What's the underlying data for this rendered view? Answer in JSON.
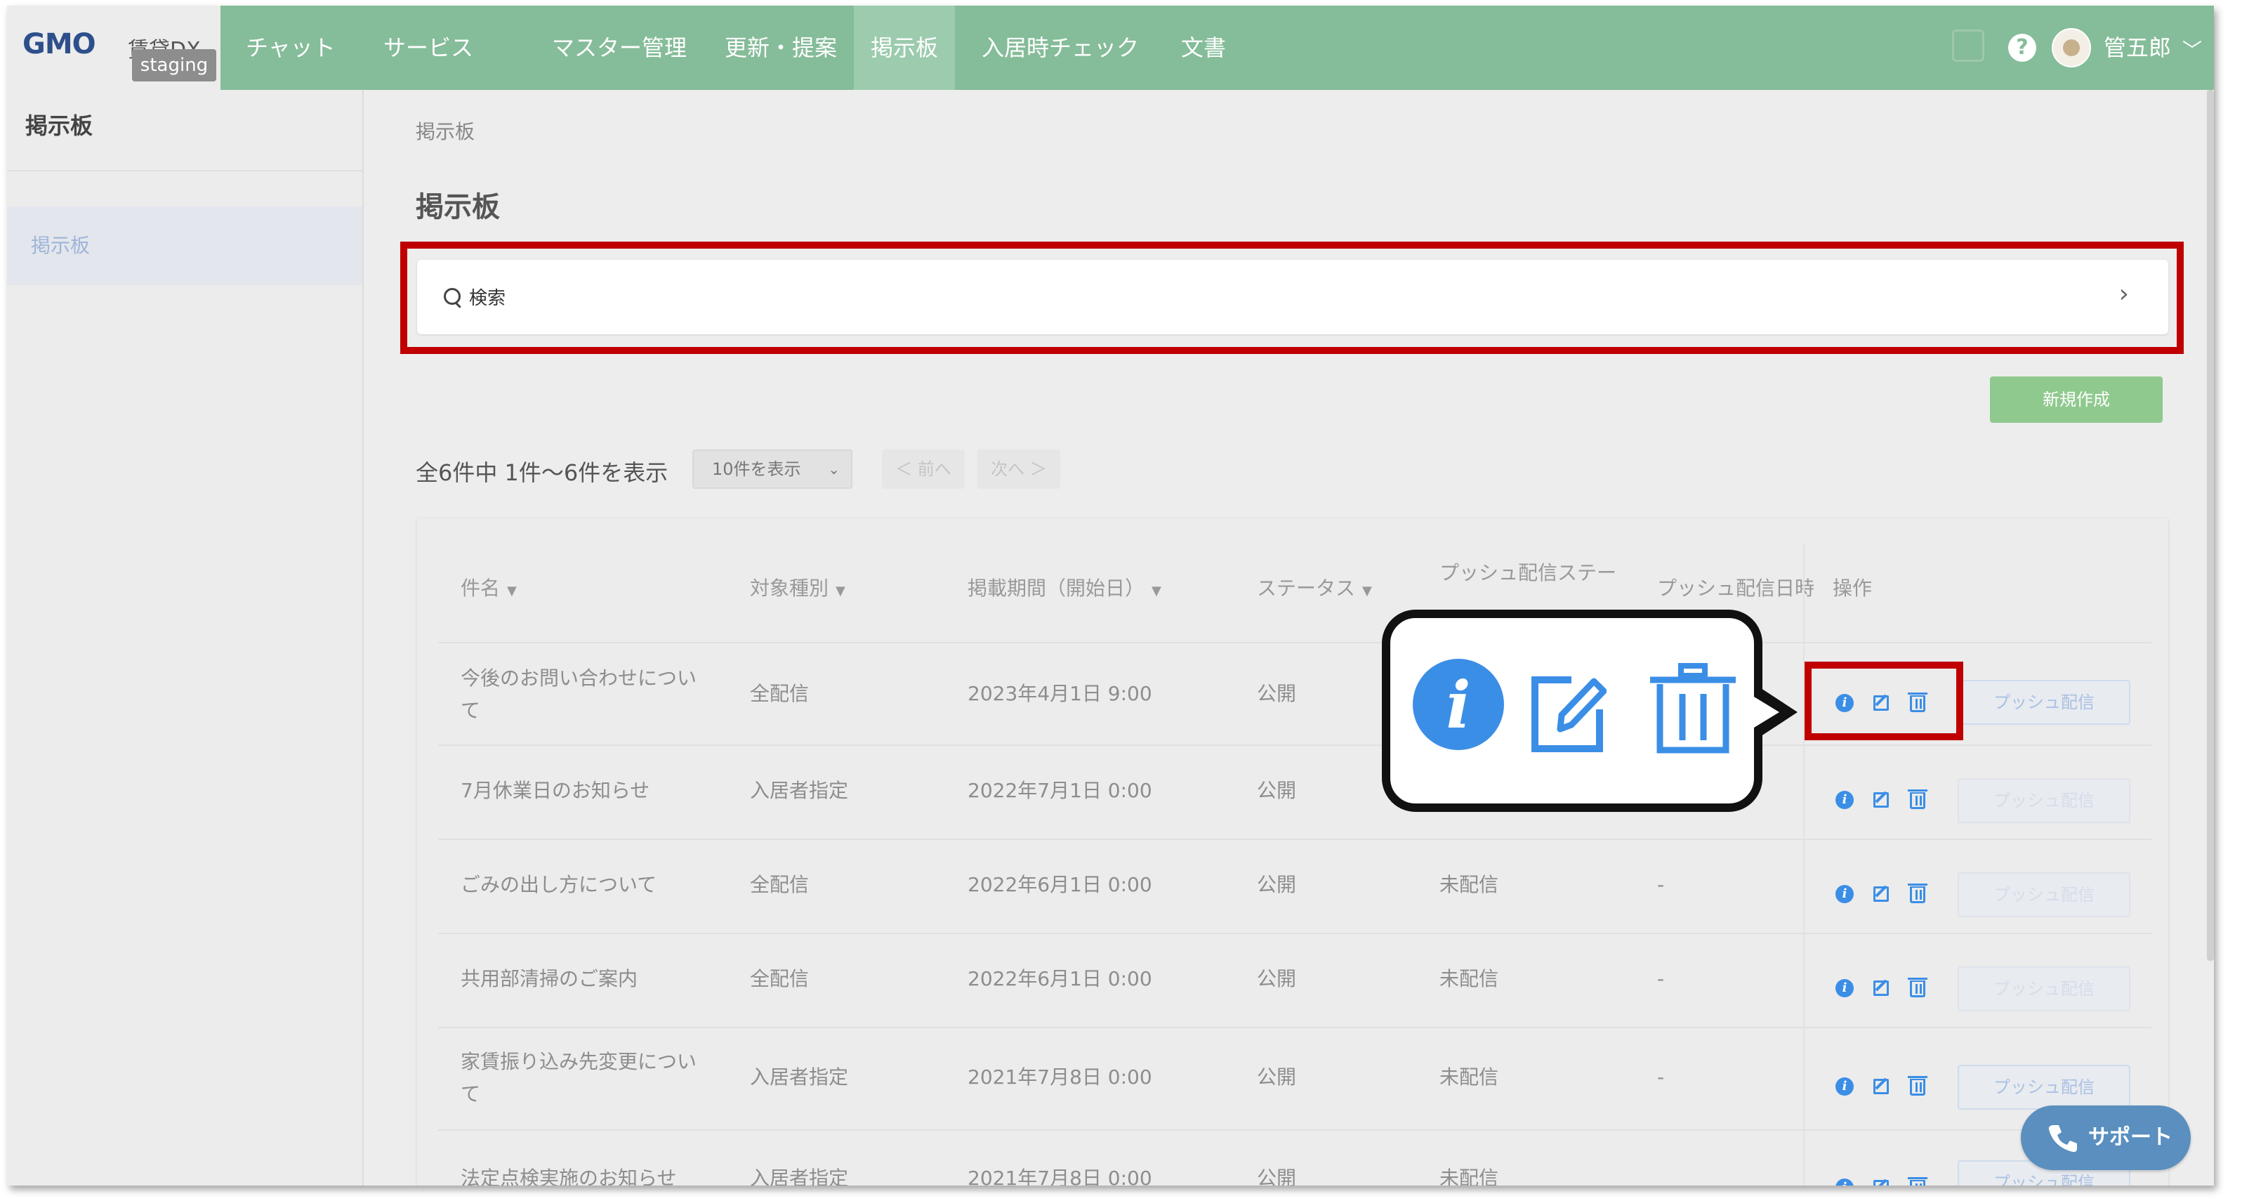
{
  "header": {
    "logo": "GMO",
    "logo_sub": "賃貸DX",
    "env_badge": "staging",
    "nav": [
      {
        "label": "チャット"
      },
      {
        "label": "サービス"
      },
      {
        "label": "マスター管理"
      },
      {
        "label": "更新・提案"
      },
      {
        "label": "掲示板",
        "active": true
      },
      {
        "label": "入居時チェック"
      },
      {
        "label": "文書"
      }
    ],
    "help": "?",
    "user_name": "管五郎",
    "user_menu_chevron": "﹀"
  },
  "sidebar": {
    "title": "掲示板",
    "items": [
      {
        "label": "掲示板",
        "active": true
      }
    ]
  },
  "main": {
    "breadcrumb": "掲示板",
    "page_title": "掲示板",
    "search": {
      "label": "検索",
      "chevron": "›"
    },
    "new_button": "新規作成",
    "count_text": "全6件中 1件〜6件を表示",
    "per_page": {
      "selected": "10件を表示",
      "caret": "⌄"
    },
    "prev_button": "＜ 前へ",
    "next_button": "次へ ＞",
    "columns": [
      "件名",
      "対象種別",
      "掲載期間（開始日）",
      "ステータス",
      "プッシュ配信ステー",
      "プッシュ配信日時",
      "操作"
    ],
    "sort_indicator": "▼",
    "rows": [
      {
        "title_l1": "今後のお問い合わせについ",
        "title_l2": "て",
        "target": "全配信",
        "start": "2023年4月1日 9:00",
        "status": "公開",
        "push_status": "",
        "push_date": "",
        "push_enabled": true
      },
      {
        "title_l1": "7月休業日のお知らせ",
        "title_l2": "",
        "target": "入居者指定",
        "start": "2022年7月1日 0:00",
        "status": "公開",
        "push_status": "",
        "push_date": "",
        "push_enabled": false
      },
      {
        "title_l1": "ごみの出し方について",
        "title_l2": "",
        "target": "全配信",
        "start": "2022年6月1日 0:00",
        "status": "公開",
        "push_status": "未配信",
        "push_date": "-",
        "push_enabled": false
      },
      {
        "title_l1": "共用部清掃のご案内",
        "title_l2": "",
        "target": "全配信",
        "start": "2022年6月1日 0:00",
        "status": "公開",
        "push_status": "未配信",
        "push_date": "-",
        "push_enabled": false
      },
      {
        "title_l1": "家賃振り込み先変更につい",
        "title_l2": "て",
        "target": "入居者指定",
        "start": "2021年7月8日 0:00",
        "status": "公開",
        "push_status": "未配信",
        "push_date": "-",
        "push_enabled": true
      },
      {
        "title_l1": "法定点検実施のお知らせ",
        "title_l2": "",
        "target": "入居者指定",
        "start": "2021年7月8日 0:00",
        "status": "公開",
        "push_status": "未配信",
        "push_date": "",
        "push_enabled": true
      }
    ],
    "push_button": "プッシュ配信",
    "icons": [
      "info-icon",
      "edit-icon",
      "trash-icon"
    ]
  },
  "callout": {
    "icons": [
      "info-icon",
      "edit-icon",
      "trash-icon"
    ],
    "info_glyph": "i"
  },
  "support_button": "サポート",
  "colors": {
    "header": "#85bc99",
    "accent_blue": "#3b8ee6",
    "highlight_red": "#c00000",
    "new_button": "#8fc98e",
    "support": "#5a8fbf"
  }
}
